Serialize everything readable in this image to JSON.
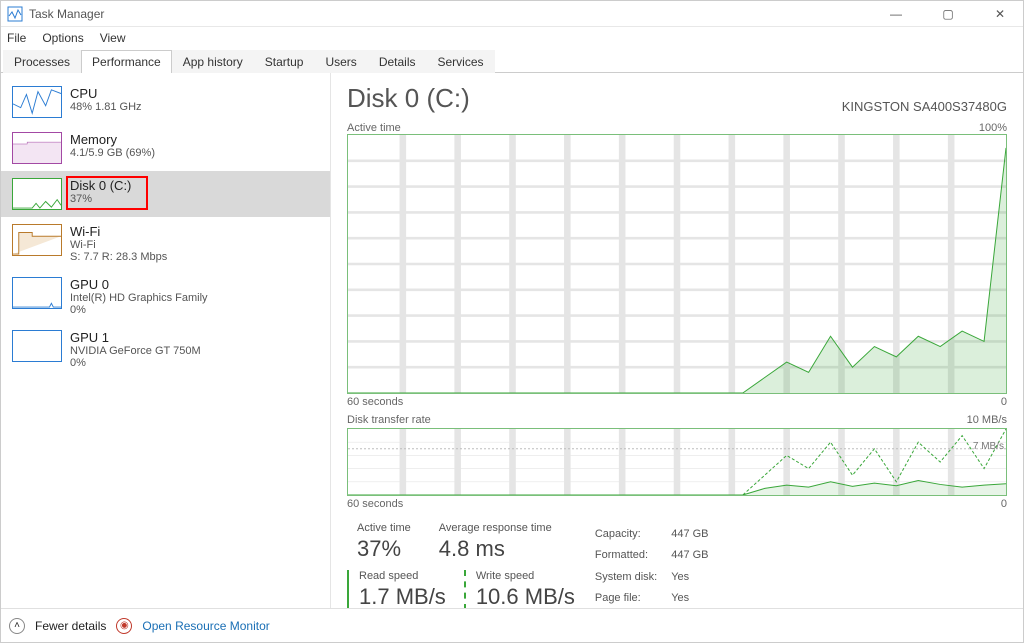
{
  "window": {
    "title": "Task Manager"
  },
  "menu": {
    "file": "File",
    "options": "Options",
    "view": "View"
  },
  "tabs": {
    "processes": "Processes",
    "performance": "Performance",
    "app_history": "App history",
    "startup": "Startup",
    "users": "Users",
    "details": "Details",
    "services": "Services"
  },
  "sidebar": {
    "cpu": {
      "name": "CPU",
      "sub": "48% 1.81 GHz"
    },
    "memory": {
      "name": "Memory",
      "sub": "4.1/5.9 GB (69%)"
    },
    "disk": {
      "name": "Disk 0 (C:)",
      "sub": "37%"
    },
    "wifi": {
      "name": "Wi-Fi",
      "sub1": "Wi-Fi",
      "sub2": "S: 7.7 R: 28.3 Mbps"
    },
    "gpu0": {
      "name": "GPU 0",
      "sub1": "Intel(R) HD Graphics Family",
      "sub2": "0%"
    },
    "gpu1": {
      "name": "GPU 1",
      "sub1": "NVIDIA GeForce GT 750M",
      "sub2": "0%"
    }
  },
  "header": {
    "title": "Disk 0 (C:)",
    "model": "KINGSTON SA400S37480G"
  },
  "graph1": {
    "label": "Active time",
    "max": "100%",
    "x_left": "60 seconds",
    "x_right": "0"
  },
  "graph2": {
    "label": "Disk transfer rate",
    "max": "10 MB/s",
    "ref": "7 MB/s",
    "x_left": "60 seconds",
    "x_right": "0"
  },
  "stats": {
    "active_label": "Active time",
    "active_value": "37%",
    "resp_label": "Average response time",
    "resp_value": "4.8 ms",
    "read_label": "Read speed",
    "read_value": "1.7 MB/s",
    "write_label": "Write speed",
    "write_value": "10.6 MB/s"
  },
  "info": {
    "capacity_l": "Capacity:",
    "capacity_v": "447 GB",
    "formatted_l": "Formatted:",
    "formatted_v": "447 GB",
    "system_l": "System disk:",
    "system_v": "Yes",
    "page_l": "Page file:",
    "page_v": "Yes"
  },
  "footer": {
    "fewer": "Fewer details",
    "monitor": "Open Resource Monitor"
  },
  "chart_data": [
    {
      "type": "line",
      "title": "Active time",
      "ylabel": "%",
      "ylim": [
        0,
        100
      ],
      "xlabel": "seconds ago",
      "xlim": [
        60,
        0
      ],
      "x": [
        60,
        58,
        56,
        54,
        52,
        50,
        48,
        46,
        44,
        42,
        40,
        38,
        36,
        34,
        32,
        30,
        28,
        26,
        24,
        22,
        20,
        18,
        16,
        14,
        12,
        10,
        8,
        6,
        4,
        2,
        0
      ],
      "values": [
        0,
        0,
        0,
        0,
        0,
        0,
        0,
        0,
        0,
        0,
        0,
        0,
        0,
        0,
        0,
        0,
        0,
        0,
        0,
        6,
        12,
        8,
        22,
        10,
        18,
        14,
        22,
        18,
        24,
        20,
        95
      ]
    },
    {
      "type": "line",
      "title": "Disk transfer rate",
      "ylabel": "MB/s",
      "ylim": [
        0,
        10
      ],
      "reference": 7,
      "xlabel": "seconds ago",
      "xlim": [
        60,
        0
      ],
      "series": [
        {
          "name": "Read",
          "x": [
            60,
            58,
            56,
            54,
            52,
            50,
            48,
            46,
            44,
            42,
            40,
            38,
            36,
            34,
            32,
            30,
            28,
            26,
            24,
            22,
            20,
            18,
            16,
            14,
            12,
            10,
            8,
            6,
            4,
            2,
            0
          ],
          "values": [
            0,
            0,
            0,
            0,
            0,
            0,
            0,
            0,
            0,
            0,
            0,
            0,
            0,
            0,
            0,
            0,
            0,
            0,
            0,
            1.0,
            1.5,
            1.2,
            2.0,
            1.3,
            1.8,
            1.4,
            2.2,
            1.6,
            1.2,
            1.5,
            1.7
          ]
        },
        {
          "name": "Write",
          "x": [
            60,
            58,
            56,
            54,
            52,
            50,
            48,
            46,
            44,
            42,
            40,
            38,
            36,
            34,
            32,
            30,
            28,
            26,
            24,
            22,
            20,
            18,
            16,
            14,
            12,
            10,
            8,
            6,
            4,
            2,
            0
          ],
          "values": [
            0,
            0,
            0,
            0,
            0,
            0,
            0,
            0,
            0,
            0,
            0,
            0,
            0,
            0,
            0,
            0,
            0,
            0,
            0,
            3,
            6,
            4,
            8,
            3,
            7,
            2,
            8,
            5,
            9,
            4,
            10
          ]
        }
      ]
    }
  ]
}
